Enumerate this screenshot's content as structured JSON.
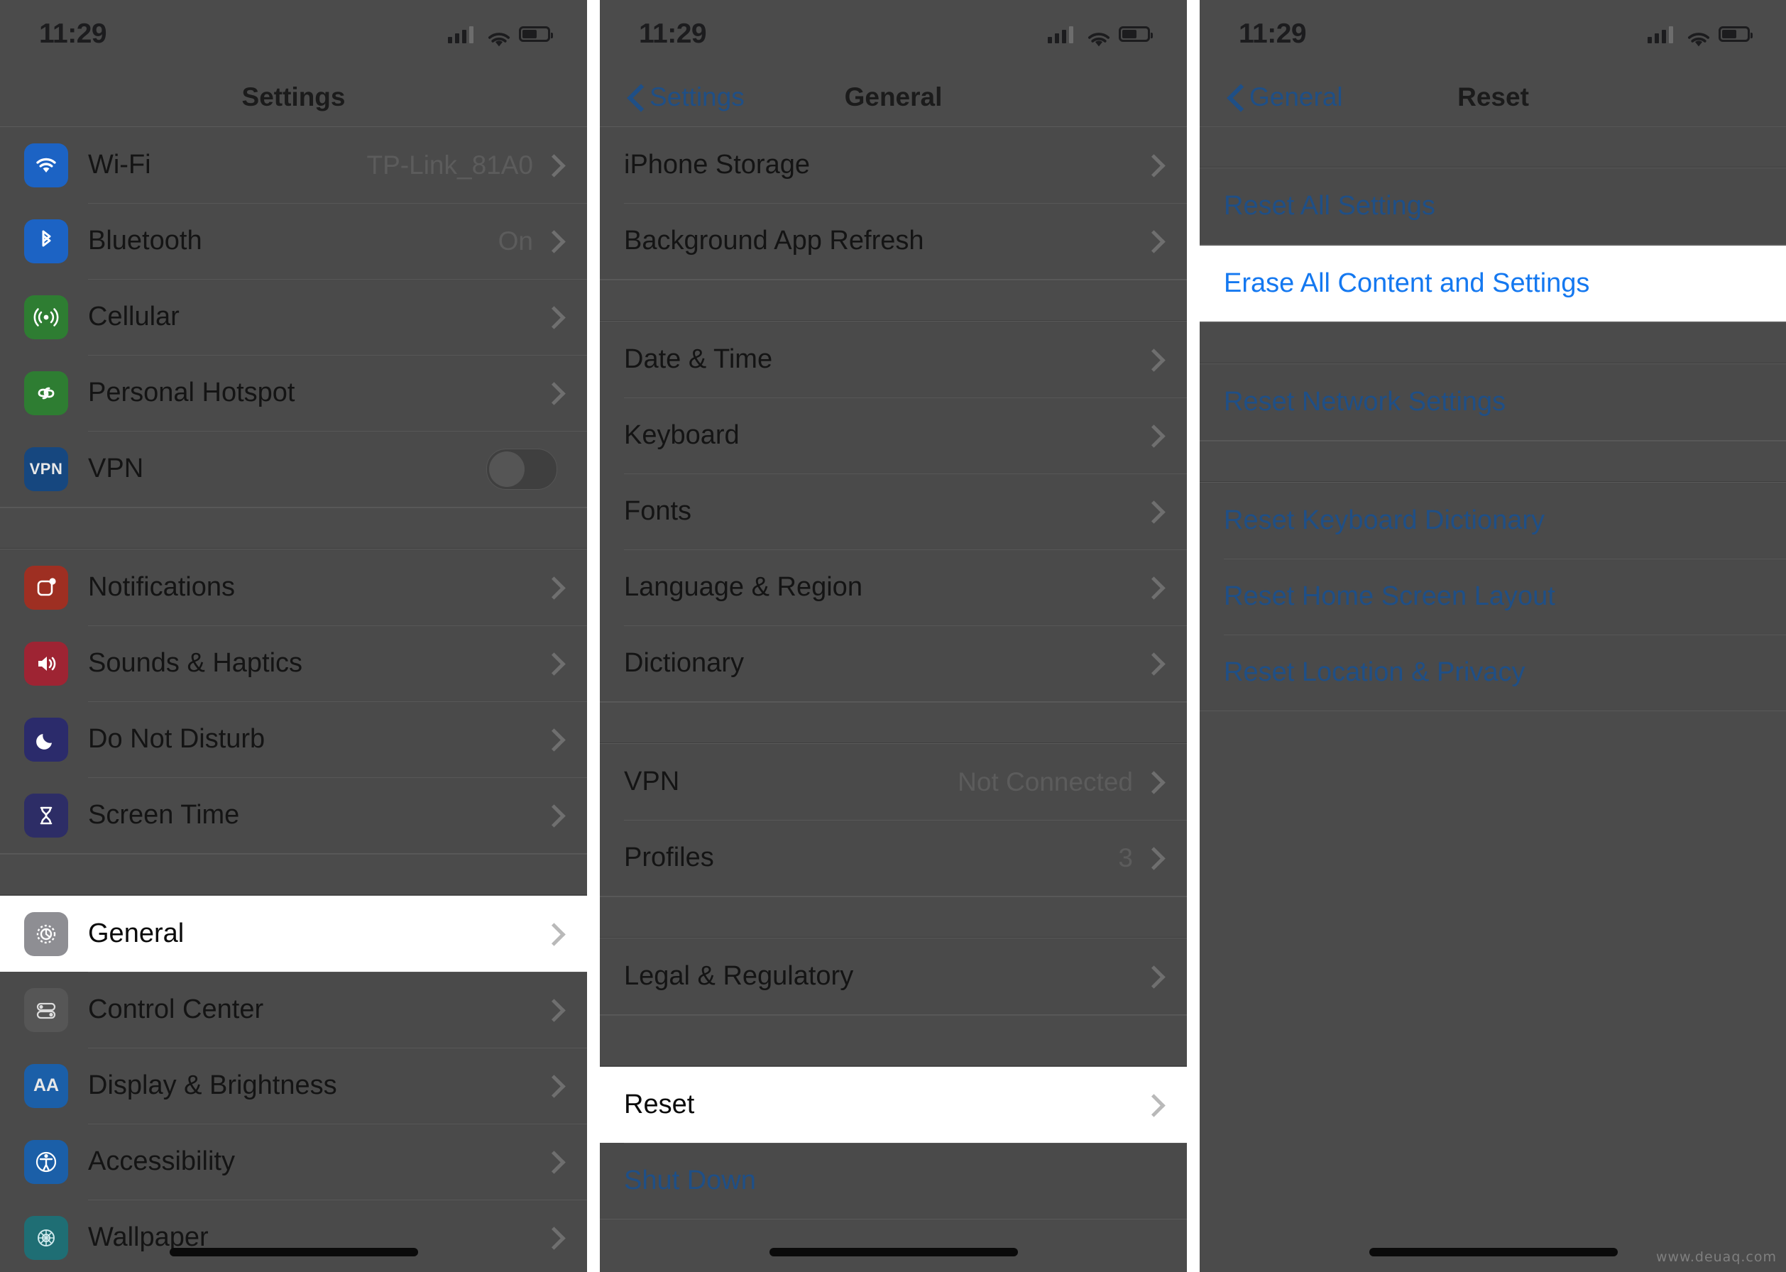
{
  "watermark": "www.deuaq.com",
  "status_bar": {
    "time": "11:29",
    "signal_icon": "cellular-bars-icon",
    "wifi_icon": "wifi-icon",
    "battery_icon": "battery-icon"
  },
  "panel1": {
    "nav": {
      "title": "Settings"
    },
    "groups": [
      {
        "rows": [
          {
            "icon": "wifi-icon",
            "label": "Wi-Fi",
            "value": "TP-Link_81A0",
            "accessory": "chevron"
          },
          {
            "icon": "bluetooth-icon",
            "label": "Bluetooth",
            "value": "On",
            "accessory": "chevron"
          },
          {
            "icon": "cellular-icon",
            "label": "Cellular",
            "value": "",
            "accessory": "chevron"
          },
          {
            "icon": "personal-hotspot-icon",
            "label": "Personal Hotspot",
            "value": "",
            "accessory": "chevron"
          },
          {
            "icon": "vpn-icon",
            "label": "VPN",
            "value": "",
            "accessory": "toggle",
            "toggle_on": false
          }
        ]
      },
      {
        "rows": [
          {
            "icon": "notifications-icon",
            "label": "Notifications",
            "value": "",
            "accessory": "chevron"
          },
          {
            "icon": "sounds-haptics-icon",
            "label": "Sounds & Haptics",
            "value": "",
            "accessory": "chevron"
          },
          {
            "icon": "do-not-disturb-icon",
            "label": "Do Not Disturb",
            "value": "",
            "accessory": "chevron"
          },
          {
            "icon": "screen-time-icon",
            "label": "Screen Time",
            "value": "",
            "accessory": "chevron"
          }
        ]
      },
      {
        "rows": [
          {
            "icon": "general-gear-icon",
            "label": "General",
            "value": "",
            "accessory": "chevron",
            "highlighted": true
          },
          {
            "icon": "control-center-icon",
            "label": "Control Center",
            "value": "",
            "accessory": "chevron"
          },
          {
            "icon": "display-brightness-icon",
            "label": "Display & Brightness",
            "value": "",
            "accessory": "chevron"
          },
          {
            "icon": "accessibility-icon",
            "label": "Accessibility",
            "value": "",
            "accessory": "chevron"
          },
          {
            "icon": "wallpaper-icon",
            "label": "Wallpaper",
            "value": "",
            "accessory": "chevron"
          }
        ]
      }
    ]
  },
  "panel2": {
    "nav": {
      "back_label": "Settings",
      "title": "General"
    },
    "groups": [
      {
        "rows": [
          {
            "label": "iPhone Storage",
            "value": "",
            "accessory": "chevron"
          },
          {
            "label": "Background App Refresh",
            "value": "",
            "accessory": "chevron"
          }
        ]
      },
      {
        "rows": [
          {
            "label": "Date & Time",
            "value": "",
            "accessory": "chevron"
          },
          {
            "label": "Keyboard",
            "value": "",
            "accessory": "chevron"
          },
          {
            "label": "Fonts",
            "value": "",
            "accessory": "chevron"
          },
          {
            "label": "Language & Region",
            "value": "",
            "accessory": "chevron"
          },
          {
            "label": "Dictionary",
            "value": "",
            "accessory": "chevron"
          }
        ]
      },
      {
        "rows": [
          {
            "label": "VPN",
            "value": "Not Connected",
            "accessory": "chevron"
          },
          {
            "label": "Profiles",
            "value": "3",
            "accessory": "chevron"
          }
        ]
      },
      {
        "rows": [
          {
            "label": "Legal & Regulatory",
            "value": "",
            "accessory": "chevron"
          }
        ]
      },
      {
        "rows": [
          {
            "label": "Reset",
            "value": "",
            "accessory": "chevron",
            "highlighted": true
          },
          {
            "label": "Shut Down",
            "value": "",
            "accessory": "none",
            "link": true
          }
        ]
      }
    ]
  },
  "panel3": {
    "nav": {
      "back_label": "General",
      "title": "Reset"
    },
    "groups": [
      {
        "rows": [
          {
            "label": "Reset All Settings",
            "link": true
          }
        ]
      },
      {
        "rows": [
          {
            "label": "Erase All Content and Settings",
            "link": true,
            "highlighted": true
          }
        ]
      },
      {
        "rows": [
          {
            "label": "Reset Network Settings",
            "link": true
          }
        ]
      },
      {
        "rows": [
          {
            "label": "Reset Keyboard Dictionary",
            "link": true
          },
          {
            "label": "Reset Home Screen Layout",
            "link": true
          },
          {
            "label": "Reset Location & Privacy",
            "link": true
          }
        ]
      }
    ]
  },
  "colors": {
    "dimmed_background": "#4b4b4b",
    "highlight_background": "#ffffff",
    "link_blue": "#1f4f86",
    "highlight_link_blue": "#1478f0",
    "primary_text": "#141414",
    "secondary_text": "#5c5c5c"
  }
}
